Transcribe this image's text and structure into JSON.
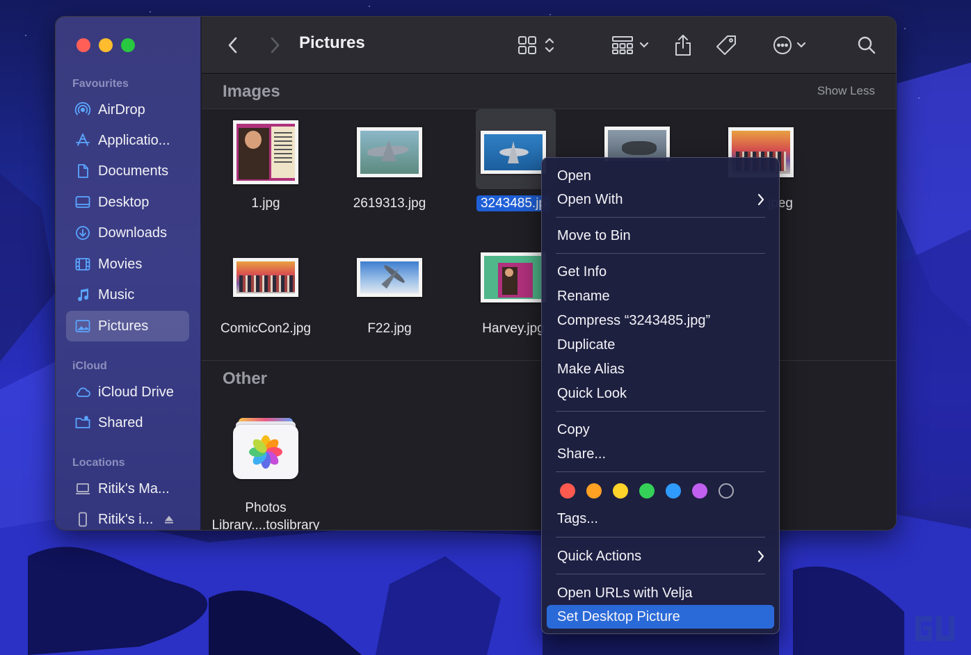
{
  "window": {
    "title": "Pictures"
  },
  "sidebar": {
    "sections": [
      {
        "title": "Favourites",
        "items": [
          {
            "label": "AirDrop",
            "icon": "airdrop-icon"
          },
          {
            "label": "Applicatio...",
            "icon": "applications-icon"
          },
          {
            "label": "Documents",
            "icon": "document-icon"
          },
          {
            "label": "Desktop",
            "icon": "desktop-icon"
          },
          {
            "label": "Downloads",
            "icon": "download-icon"
          },
          {
            "label": "Movies",
            "icon": "film-icon"
          },
          {
            "label": "Music",
            "icon": "music-note-icon"
          },
          {
            "label": "Pictures",
            "icon": "photo-icon",
            "selected": true
          }
        ]
      },
      {
        "title": "iCloud",
        "items": [
          {
            "label": "iCloud Drive",
            "icon": "cloud-icon"
          },
          {
            "label": "Shared",
            "icon": "shared-folder-icon"
          }
        ]
      },
      {
        "title": "Locations",
        "items": [
          {
            "label": "Ritik's Ma...",
            "icon": "laptop-icon"
          },
          {
            "label": "Ritik's i...",
            "icon": "phone-icon",
            "eject": true
          }
        ]
      }
    ]
  },
  "toolbar": {
    "buttons": [
      "back-icon",
      "forward-icon",
      "icon-view-icon",
      "group-icon",
      "share-icon",
      "tag-icon",
      "more-actions-icon",
      "search-icon"
    ]
  },
  "groups": {
    "images": {
      "title": "Images",
      "action": "Show Less",
      "files": [
        {
          "name": "1.jpg"
        },
        {
          "name": "2619313.jpg"
        },
        {
          "name": "3243485.jp",
          "selected": true
        },
        {
          "name": ""
        },
        {
          "name": "jpeg"
        },
        {
          "name": "ComicCon2.jpg"
        },
        {
          "name": "F22.jpg"
        },
        {
          "name": "Harvey.jpg"
        }
      ]
    },
    "other": {
      "title": "Other",
      "files": [
        {
          "name_line1": "Photos",
          "name_line2": "Library....toslibrary"
        }
      ]
    }
  },
  "context_menu": {
    "items": [
      {
        "label": "Open"
      },
      {
        "label": "Open With",
        "submenu": true
      },
      {
        "label": "Move to Bin"
      },
      {
        "label": "Get Info"
      },
      {
        "label": "Rename"
      },
      {
        "label": "Compress “3243485.jpg”"
      },
      {
        "label": "Duplicate"
      },
      {
        "label": "Make Alias"
      },
      {
        "label": "Quick Look"
      },
      {
        "label": "Copy"
      },
      {
        "label": "Share..."
      },
      {
        "label": "Tags..."
      },
      {
        "label": "Quick Actions",
        "submenu": true
      },
      {
        "label": "Open URLs with Velja"
      },
      {
        "label": "Set Desktop Picture",
        "highlighted": true
      }
    ],
    "tag_colors": [
      "#ff5a4f",
      "#ffa123",
      "#ffd42a",
      "#34d058",
      "#2f9bff",
      "#c15ff0",
      "none"
    ]
  },
  "colors": {
    "accent": "#2a6ad8",
    "selection": "#1f5fd6"
  }
}
